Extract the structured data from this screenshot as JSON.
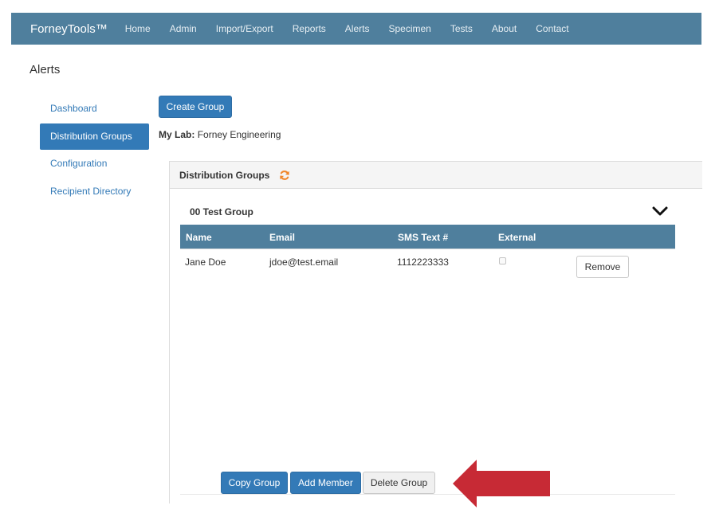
{
  "nav": {
    "brand": "ForneyTools™",
    "links": [
      "Home",
      "Admin",
      "Import/Export",
      "Reports",
      "Alerts",
      "Specimen",
      "Tests",
      "About",
      "Contact"
    ]
  },
  "page": {
    "title": "Alerts"
  },
  "sidebar": {
    "items": [
      {
        "label": "Dashboard",
        "active": false
      },
      {
        "label": "Distribution Groups",
        "active": true
      },
      {
        "label": "Configuration",
        "active": false
      },
      {
        "label": "Recipient Directory",
        "active": false
      }
    ]
  },
  "actions": {
    "create_group": "Create Group"
  },
  "lab": {
    "label": "My Lab:",
    "name": "Forney Engineering"
  },
  "panel": {
    "title": "Distribution Groups",
    "refresh_icon": "refresh-icon"
  },
  "group": {
    "name": "00 Test Group",
    "toggle_icon": "chevron-down-icon",
    "columns": [
      "Name",
      "Email",
      "SMS Text #",
      "External"
    ],
    "members": [
      {
        "name": "Jane Doe",
        "email": "jdoe@test.email",
        "sms": "1112223333",
        "external": false,
        "remove_label": "Remove"
      }
    ],
    "buttons": {
      "copy": "Copy Group",
      "add": "Add Member",
      "delete": "Delete Group"
    }
  },
  "colors": {
    "navbar": "#4f7f9d",
    "primary": "#337ab7",
    "arrow": "#c72a35",
    "refresh": "#f0862a"
  }
}
